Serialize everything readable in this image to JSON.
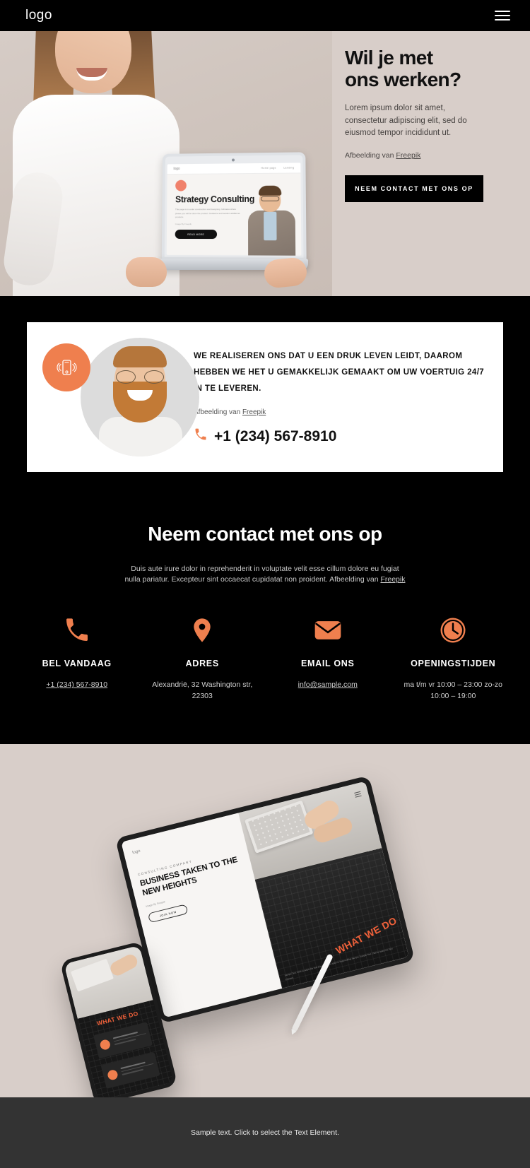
{
  "colors": {
    "accent": "#ef7f4e",
    "dark": "#000000",
    "beige": "#d8cec9",
    "footer_bg": "#333333"
  },
  "header": {
    "logo": "logo",
    "menu_icon": "hamburger-icon"
  },
  "hero": {
    "title": "Wil je met ons werken?",
    "paragraph": "Lorem ipsum dolor sit amet, consectetur adipiscing elit, sed do eiusmod tempor incididunt ut.",
    "credit_prefix": "Afbeelding van ",
    "credit_link": "Freepik",
    "cta_label": "NEEM CONTACT MET ONS OP",
    "laptop": {
      "logo": "logo",
      "nav_links": [
        "Home page",
        "Landing"
      ],
      "title": "Strategy Consulting",
      "paragraph": "This page is in under construction and designing. Indicates where please you will be done the product. Guidance and location additional products.",
      "credit": "Image By Freepik",
      "button": "READ MORE"
    }
  },
  "testimonial": {
    "badge_icon": "ringing-phone-icon",
    "avatar_icon": "portrait-avatar",
    "quote": "WE REALISEREN ONS DAT U EEN DRUK LEVEN LEIDT, DAAROM HEBBEN WE HET U GEMAKKELIJK GEMAAKT OM UW VOERTUIG 24/7 IN TE LEVEREN.",
    "credit_prefix": "Afbeelding van ",
    "credit_link": "Freepik",
    "phone": "+1 (234) 567-8910",
    "phone_icon": "phone-icon"
  },
  "contact": {
    "title": "Neem contact met ons op",
    "subtitle_line1": "Duis aute irure dolor in reprehenderit in voluptate velit esse cillum dolore",
    "subtitle_line2": "eu fugiat nulla pariatur. Excepteur sint occaecat cupidatat non proident.",
    "credit_prefix": "Afbeelding van ",
    "credit_link": "Freepik",
    "columns": [
      {
        "icon": "phone-icon",
        "title": "BEL VANDAAG",
        "text_line1": "+1 (234) 567-8910",
        "text_line2": "",
        "is_link": true
      },
      {
        "icon": "location-pin-icon",
        "title": "ADRES",
        "text_line1": "Alexandrië, 32 Washington",
        "text_line2": "str, 22303",
        "is_link": false
      },
      {
        "icon": "envelope-icon",
        "title": "EMAIL ONS",
        "text_line1": "info@sample.com",
        "text_line2": "",
        "is_link": true
      },
      {
        "icon": "clock-icon",
        "title": "OPENINGSTIJDEN",
        "text_line1": "ma t/m vr 10:00 – 23:00",
        "text_line2": "zo-zo 10:00 – 19:00",
        "is_link": false
      }
    ]
  },
  "devices": {
    "tablet": {
      "logo": "logo",
      "kicker": "CONSULTING COMPANY",
      "title": "BUSINESS TAKEN TO THE NEW HEIGHTS",
      "credit": "Image By Freepik",
      "button": "JOIN NOW",
      "overlay_text": "WHAT WE DO",
      "small_text": "Sample Text. Click to select the Text Element. Click again to begin editing the text. Sample Text. Click to select the Text Element."
    },
    "phone": {
      "overlay_text": "WHAT WE DO"
    },
    "stylus": "stylus-pen"
  },
  "footer": {
    "text": "Sample text. Click to select the Text Element."
  }
}
